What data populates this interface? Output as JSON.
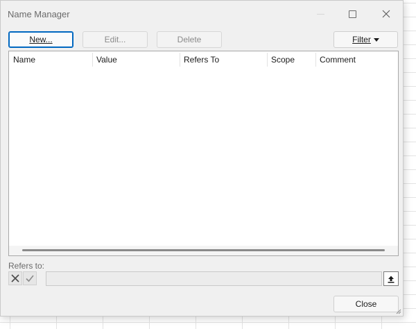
{
  "window": {
    "title": "Name Manager"
  },
  "toolbar": {
    "new_prefix": "",
    "new_accel": "N",
    "new_rest": "ew...",
    "edit_label": "Edit...",
    "delete_label": "Delete",
    "filter_accel": "F",
    "filter_rest": "ilter"
  },
  "table": {
    "columns": [
      "Name",
      "Value",
      "Refers To",
      "Scope",
      "Comment"
    ],
    "rows": []
  },
  "refers_to": {
    "label": "Refers to:",
    "value": ""
  },
  "footer": {
    "close_label": "Close"
  },
  "icons": {
    "cancel": "x-icon",
    "accept": "check-icon",
    "collapse": "upload-arrow-icon",
    "maximize": "maximize-icon",
    "close": "close-icon"
  },
  "colors": {
    "accent": "#0067c0",
    "dialog_bg": "#f0f0f0"
  }
}
